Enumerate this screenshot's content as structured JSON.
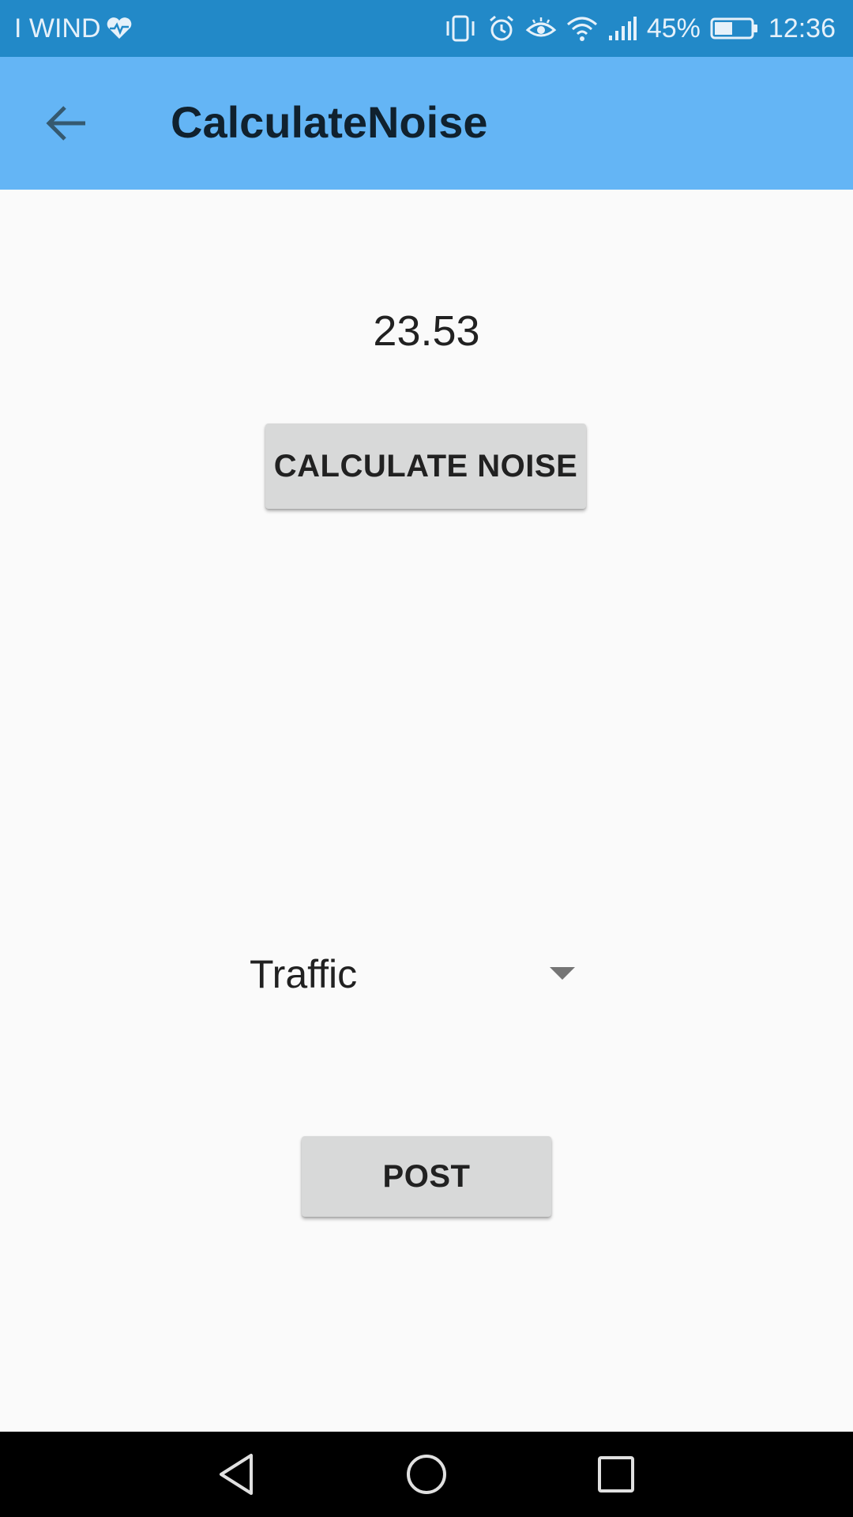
{
  "status_bar": {
    "carrier": "I WIND",
    "battery_percent": "45%",
    "time": "12:36",
    "icons": [
      "heart-pulse-icon",
      "vibrate-icon",
      "alarm-icon",
      "eye-icon",
      "wifi-icon",
      "signal-icon",
      "battery-icon"
    ]
  },
  "app_bar": {
    "title": "CalculateNoise",
    "back_icon": "arrow-back-icon"
  },
  "main": {
    "noise_value": "23.53",
    "calculate_button_label": "CALCULATE NOISE",
    "spinner": {
      "selected": "Traffic"
    },
    "post_button_label": "POST"
  },
  "nav_bar": {
    "icons": [
      "back-triangle-icon",
      "home-circle-icon",
      "recents-square-icon"
    ]
  },
  "colors": {
    "status_bar": "#2289c8",
    "app_bar": "#64b5f5",
    "background": "#fafafa",
    "button": "#d8d9d9"
  }
}
